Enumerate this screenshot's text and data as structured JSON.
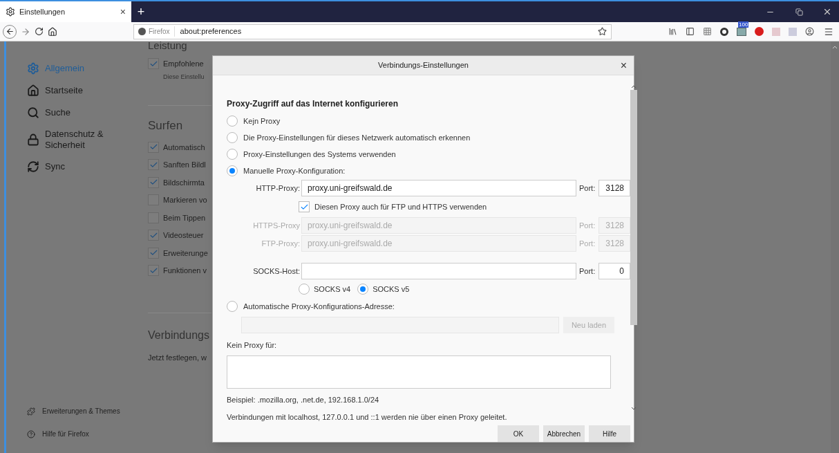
{
  "browser": {
    "tab": {
      "title": "Einstellungen",
      "close": "×",
      "selected": true
    },
    "new_tab": "+",
    "urlbar": {
      "identity": "Firefox",
      "url": "about:preferences"
    },
    "badge": "100"
  },
  "sidebar": {
    "items": [
      {
        "label": "Allgemein",
        "selected": true,
        "kind": "gear"
      },
      {
        "label": "Startseite",
        "selected": false,
        "kind": "home"
      },
      {
        "label": "Suche",
        "selected": false,
        "kind": "search"
      },
      {
        "label": "Datenschutz & Sicherheit",
        "selected": false,
        "kind": "lock"
      },
      {
        "label": "Sync",
        "selected": false,
        "kind": "sync"
      }
    ],
    "footer": [
      {
        "label": "Erweiterungen & Themes",
        "kind": "puzzle"
      },
      {
        "label": "Hilfe für Firefox",
        "kind": "help"
      }
    ]
  },
  "content": {
    "leistung": {
      "title": "Leistung",
      "option": {
        "label": "Empfohlene",
        "checked": true
      },
      "note": "Diese Einstellu"
    },
    "surfen": {
      "title": "Surfen",
      "options": [
        {
          "label": "Automatisch",
          "checked": true
        },
        {
          "label": "Sanften Bildl",
          "checked": true
        },
        {
          "label": "Bildschirmta",
          "checked": true
        },
        {
          "label": "Markieren vo",
          "checked": false
        },
        {
          "label": "Beim Tippen",
          "checked": false
        },
        {
          "label": "Videosteuer",
          "checked": true
        },
        {
          "label": "Erweiterunge",
          "checked": true
        },
        {
          "label": "Funktionen v",
          "checked": true
        }
      ]
    },
    "verbindung": {
      "title": "Verbindungs",
      "text": "Jetzt festlegen, w"
    }
  },
  "dialog": {
    "title": "Verbindungs-Einstellungen",
    "close": "×",
    "heading": "Proxy-Zugriff auf das Internet konfigurieren",
    "modes": [
      {
        "label": "Kejn Proxy",
        "selected": false,
        "kind": "plain"
      },
      {
        "label": "Die Proxy-Einstellungen für dieses Netzwerk automatisch erkennen",
        "selected": false,
        "kind": "plain"
      },
      {
        "label": "Proxy-Einstellungen des Systems verwenden",
        "selected": false,
        "kind": "plain"
      },
      {
        "label": "Manuelle Proxy-Konfiguration:",
        "selected": true,
        "kind": "manual"
      },
      {
        "label": "Automatische Proxy-Konfigurations-Adresse:",
        "selected": false,
        "kind": "auto"
      }
    ],
    "proxies": [
      {
        "label": "HTTP-Proxy:",
        "value": "proxy.uni-greifswald.de",
        "port_label": "Port:",
        "port": "3128",
        "disabled": false
      },
      {
        "label": "HTTPS-Proxy",
        "value": "proxy.uni-greifswald.de",
        "port_label": "Port:",
        "port": "3128",
        "disabled": true
      },
      {
        "label": "FTP-Proxy:",
        "value": "proxy.uni-greifswald.de",
        "port_label": "Port:",
        "port": "3128",
        "disabled": true
      }
    ],
    "share": {
      "label": "Diesen Proxy auch für FTP und HTTPS verwenden",
      "checked": true
    },
    "socks": {
      "label": "SOCKS-Host:",
      "port_label": "Port:",
      "port": "0",
      "disabled": false
    },
    "socks_versions": [
      {
        "label": "SOCKS v4",
        "selected": false
      },
      {
        "label": "SOCKS v5",
        "selected": true
      }
    ],
    "reload": {
      "label": "Neu laden",
      "disabled": true
    },
    "no_proxy": {
      "label": "Kein Proxy für:"
    },
    "example": "Beispiel: .mozilla.org, .net.de, 192.168.1.0/24",
    "note": "Verbindungen mit localhost, 127.0.0.1 und ::1 werden nie über einen Proxy geleitet.",
    "buttons": [
      "OK",
      "Abbrechen",
      "Hilfe"
    ]
  }
}
